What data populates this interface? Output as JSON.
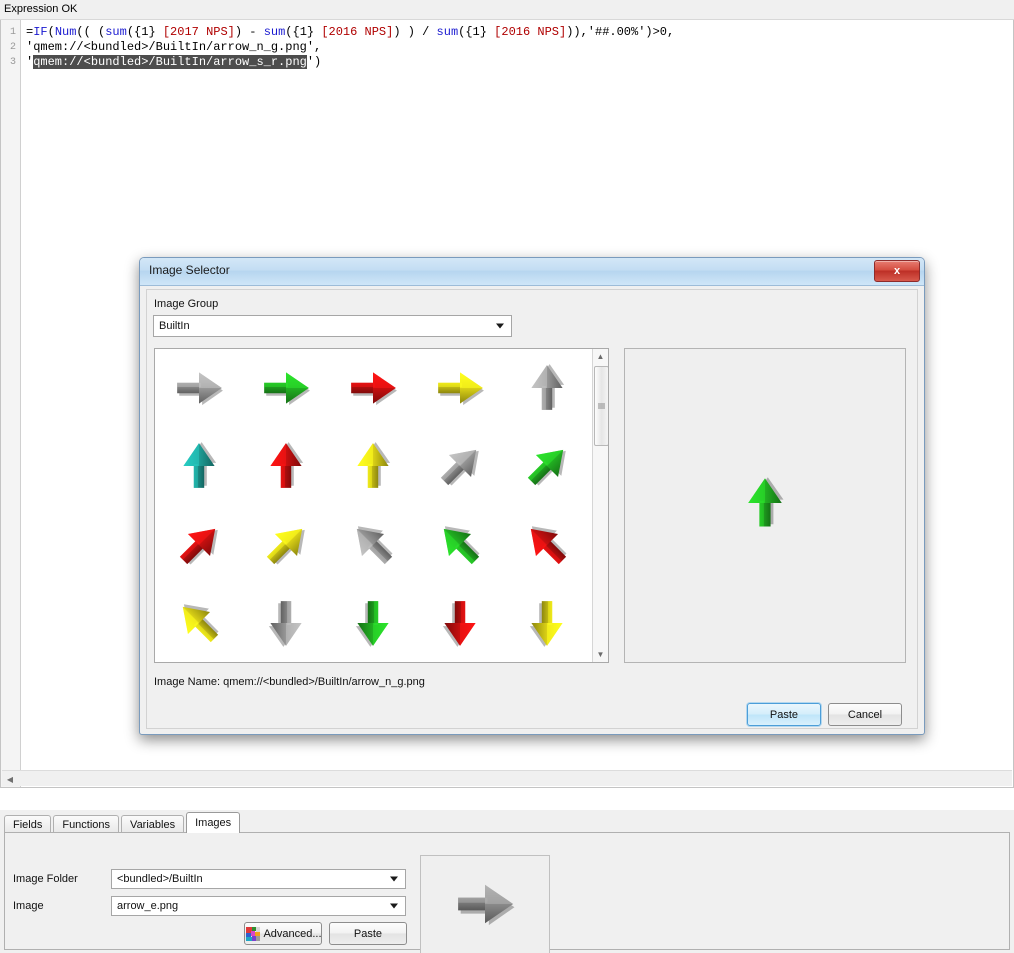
{
  "status_bar": {
    "text": "Expression OK"
  },
  "expression_editor": {
    "line_numbers": [
      "1",
      "2",
      "3"
    ],
    "lines": [
      [
        {
          "t": "=",
          "k": "plain"
        },
        {
          "t": "IF",
          "k": "fn"
        },
        {
          "t": "(",
          "k": "plain"
        },
        {
          "t": "Num",
          "k": "fn"
        },
        {
          "t": "(( (",
          "k": "plain"
        },
        {
          "t": "sum",
          "k": "fn"
        },
        {
          "t": "({1} ",
          "k": "plain"
        },
        {
          "t": "[2017 NPS]",
          "k": "fld"
        },
        {
          "t": ") - ",
          "k": "plain"
        },
        {
          "t": "sum",
          "k": "fn"
        },
        {
          "t": "({1} ",
          "k": "plain"
        },
        {
          "t": "[2016 NPS]",
          "k": "fld"
        },
        {
          "t": ") ) / ",
          "k": "plain"
        },
        {
          "t": "sum",
          "k": "fn"
        },
        {
          "t": "({1} ",
          "k": "plain"
        },
        {
          "t": "[2016 NPS]",
          "k": "fld"
        },
        {
          "t": ")),'##.00%')>0,",
          "k": "plain"
        }
      ],
      [
        {
          "t": "'qmem://<bundled>/BuiltIn/arrow_n_g.png',",
          "k": "plain"
        }
      ],
      [
        {
          "t": "'",
          "k": "plain"
        },
        {
          "t": "qmem://<bundled>/BuiltIn/arrow_s_r.png",
          "k": "sel"
        },
        {
          "t": "')",
          "k": "plain"
        }
      ]
    ]
  },
  "dialog": {
    "title": "Image Selector",
    "close_label": "x",
    "image_group": {
      "label": "Image Group",
      "value": "BuiltIn"
    },
    "grid": {
      "images": [
        {
          "name": "arrow_e_gray",
          "dir": "e",
          "color": "#9d9d9d"
        },
        {
          "name": "arrow_e_green",
          "dir": "e",
          "color": "#23b723"
        },
        {
          "name": "arrow_e_red",
          "dir": "e",
          "color": "#cf1010"
        },
        {
          "name": "arrow_e_yellow",
          "dir": "e",
          "color": "#e3d917"
        },
        {
          "name": "arrow_n_gray",
          "dir": "n",
          "color": "#9d9d9d"
        },
        {
          "name": "arrow_n_teal",
          "dir": "n",
          "color": "#1fa39b"
        },
        {
          "name": "arrow_n_red",
          "dir": "n",
          "color": "#cf1010"
        },
        {
          "name": "arrow_n_yellow",
          "dir": "n",
          "color": "#e3d917"
        },
        {
          "name": "arrow_ne_gray",
          "dir": "ne",
          "color": "#9d9d9d"
        },
        {
          "name": "arrow_ne_green",
          "dir": "ne",
          "color": "#23b723"
        },
        {
          "name": "arrow_ne_red",
          "dir": "ne",
          "color": "#cf1010"
        },
        {
          "name": "arrow_ne_yellow",
          "dir": "ne",
          "color": "#e3d917"
        },
        {
          "name": "arrow_nw_gray",
          "dir": "nw",
          "color": "#9d9d9d"
        },
        {
          "name": "arrow_nw_green",
          "dir": "nw",
          "color": "#23b723"
        },
        {
          "name": "arrow_nw_red",
          "dir": "nw",
          "color": "#cf1010"
        },
        {
          "name": "arrow_nw_yellow",
          "dir": "nw",
          "color": "#e3d917"
        },
        {
          "name": "arrow_s_gray",
          "dir": "s",
          "color": "#9d9d9d"
        },
        {
          "name": "arrow_s_green",
          "dir": "s",
          "color": "#23b723"
        },
        {
          "name": "arrow_s_red",
          "dir": "s",
          "color": "#cf1010"
        },
        {
          "name": "arrow_s_yellow",
          "dir": "s",
          "color": "#e3d917"
        }
      ]
    },
    "preview": {
      "name": "arrow_n_g",
      "dir": "n",
      "color": "#23b723"
    },
    "image_name_text": "Image Name: qmem://<bundled>/BuiltIn/arrow_n_g.png",
    "buttons": {
      "paste": "Paste",
      "cancel": "Cancel"
    }
  },
  "bottom_panel": {
    "tabs": [
      {
        "label": "Fields",
        "active": false
      },
      {
        "label": "Functions",
        "active": false
      },
      {
        "label": "Variables",
        "active": false
      },
      {
        "label": "Images",
        "active": true
      }
    ],
    "image_folder": {
      "label": "Image Folder",
      "value": "<bundled>/BuiltIn"
    },
    "image": {
      "label": "Image",
      "value": "arrow_e.png"
    },
    "buttons": {
      "advanced": "Advanced...",
      "paste": "Paste"
    },
    "thumbnail": {
      "name": "arrow_e",
      "dir": "e",
      "color": "#8f8f8f"
    }
  },
  "colors": {
    "function_token": "#1a1ad0",
    "field_token": "#b00000",
    "selection_bg": "#4d4d4d",
    "dialog_title_bg": "#c3ddf3",
    "close_button": "#d44d40",
    "focus_blue": "#4c9ed9"
  }
}
